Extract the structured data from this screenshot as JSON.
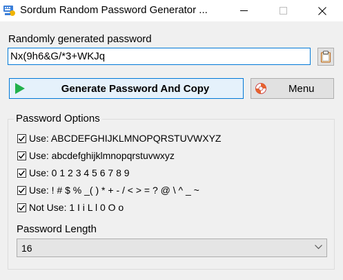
{
  "window": {
    "title": "Sordum Random Password Generator ..."
  },
  "main": {
    "generated_label": "Randomly generated password",
    "password_value": "Nx(9h6&G/*3+WKJq",
    "generate_button": "Generate Password And Copy",
    "menu_button": "Menu"
  },
  "options": {
    "group_title": "Password Options",
    "items": [
      {
        "label": "Use: ABCDEFGHIJKLMNOPQRSTUVWXYZ",
        "checked": true
      },
      {
        "label": "Use: abcdefghijklmnopqrstuvwxyz",
        "checked": true
      },
      {
        "label": "Use: 0 1 2 3 4 5 6 7 8 9",
        "checked": true
      },
      {
        "label": "Use: ! # $ % _( ) * + - / < > = ? @ \\ ^ _ ~",
        "checked": true
      },
      {
        "label": "Not Use: 1 I i L l 0 O o",
        "checked": true
      }
    ],
    "length_label": "Password Length",
    "length_value": "16"
  },
  "colors": {
    "accent": "#0078d7",
    "play_green": "#22b14c",
    "lifering_orange": "#e8632a"
  },
  "icons": [
    "app-icon",
    "minimize-icon",
    "maximize-icon",
    "close-icon",
    "clipboard-icon",
    "play-icon",
    "lifering-icon",
    "checkmark-icon",
    "chevron-down-icon"
  ]
}
